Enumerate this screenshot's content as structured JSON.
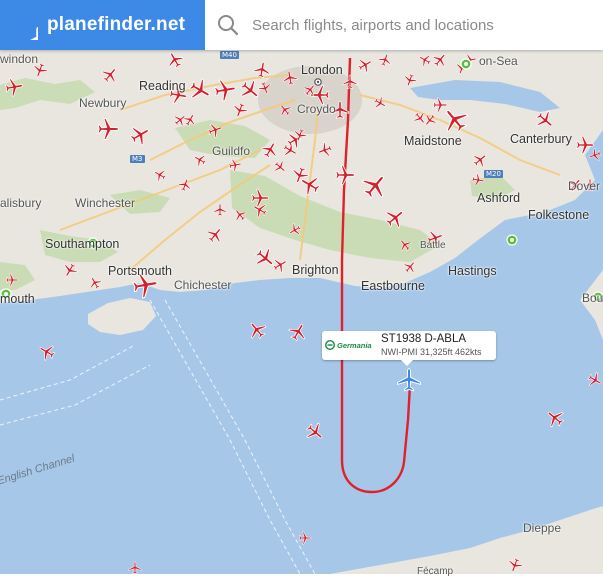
{
  "header": {
    "brand": "planefinder.net",
    "brand_icon": "plane-icon",
    "search_icon": "search-icon",
    "search_placeholder": "Search flights, airports and locations"
  },
  "colors": {
    "brand_blue": "#3d89e6",
    "plane_red": "#d3202f",
    "selected_plane": "#3c88e6",
    "track": "#e0202c",
    "land": "#e8e6e0",
    "sea": "#a7c7e9"
  },
  "map_labels": [
    {
      "name": "Swindon",
      "text": "windon"
    },
    {
      "name": "Reading",
      "text": "Reading"
    },
    {
      "name": "Newbury",
      "text": "Newbury"
    },
    {
      "name": "London",
      "text": "London"
    },
    {
      "name": "Croydon",
      "text": "Croydo"
    },
    {
      "name": "Southend",
      "text": "on-Sea"
    },
    {
      "name": "Maidstone",
      "text": "Maidstone"
    },
    {
      "name": "Canterbury",
      "text": "Canterbury"
    },
    {
      "name": "Guildford",
      "text": "Guildfo"
    },
    {
      "name": "Dover",
      "text": "Dover"
    },
    {
      "name": "Salisbury",
      "text": "alisbury"
    },
    {
      "name": "Winchester",
      "text": "Winchester"
    },
    {
      "name": "Ashford",
      "text": "Ashford"
    },
    {
      "name": "Folkestone",
      "text": "Folkestone"
    },
    {
      "name": "Southampton",
      "text": "Southampton"
    },
    {
      "name": "Battle",
      "text": "Battle"
    },
    {
      "name": "Portsmouth",
      "text": "Portsmouth"
    },
    {
      "name": "Chichester",
      "text": "Chichester"
    },
    {
      "name": "Brighton",
      "text": "Brighton"
    },
    {
      "name": "Hastings",
      "text": "Hastings"
    },
    {
      "name": "Bournemouth",
      "text": "mouth"
    },
    {
      "name": "Eastbourne",
      "text": "Eastbourne"
    },
    {
      "name": "Boulogne",
      "text": "Bou"
    },
    {
      "name": "Dieppe",
      "text": "Dieppe"
    },
    {
      "name": "Fecamp",
      "text": "Fécamp"
    }
  ],
  "water_labels": [
    {
      "name": "English Channel",
      "text": "English Channel"
    }
  ],
  "road_labels": [
    "M40",
    "M3",
    "M20"
  ],
  "selected_flight": {
    "airline": "Germania",
    "airline_logo": "germania-logo-icon",
    "callsign": "ST1938 D-ABLA",
    "details": "NWI-PMI 31,325ft 462kts"
  }
}
